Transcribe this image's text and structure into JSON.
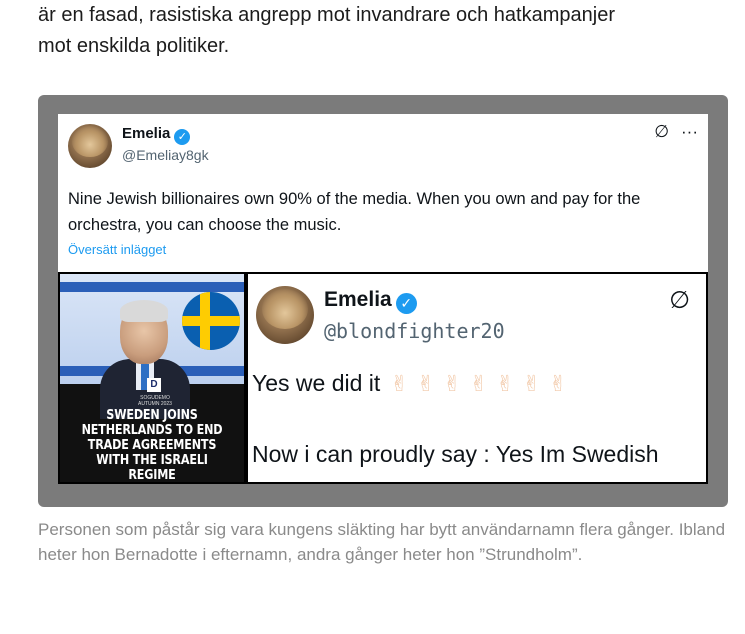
{
  "article": {
    "text_line1": "är en fasad, rasistiska angrepp mot invandrare och hatkampanjer",
    "text_line2": "mot enskilda politiker."
  },
  "embedded_tweet": {
    "author_name": "Emelia",
    "handle": "@Emeliay8gk",
    "body": "Nine Jewish billionaires own 90% of the media. When you own and pay for the orchestra, you can choose the music.",
    "translate_link": "Översätt inlägget",
    "grok_icon": "∅",
    "more_icon": "···"
  },
  "media_left": {
    "logo_letter": "D",
    "small_text": "SOGUDEMO\nAUTUMN 2023",
    "headline": "SWEDEN JOINS NETHERLANDS TO END TRADE AGREEMENTS WITH THE ISRAELI REGIME"
  },
  "tweet_screenshot": {
    "author_name": "Emelia",
    "handle": "@blondfighter20",
    "line1": "Yes we did it",
    "emojis": "✌✌✌✌✌✌✌",
    "line2": "Now i can proudly say : Yes Im  Swedish",
    "grok_icon": "∅",
    "more_icon": "·"
  },
  "caption": "Personen som påstår sig vara kungens släkting har bytt användarnamn flera gånger. Ibland heter hon Bernadotte i efternamn, andra gånger heter hon ”Strundholm”.",
  "colors": {
    "verified": "#1d9bf0",
    "frame": "#7b7b7b",
    "caption": "#8a8a8a"
  }
}
